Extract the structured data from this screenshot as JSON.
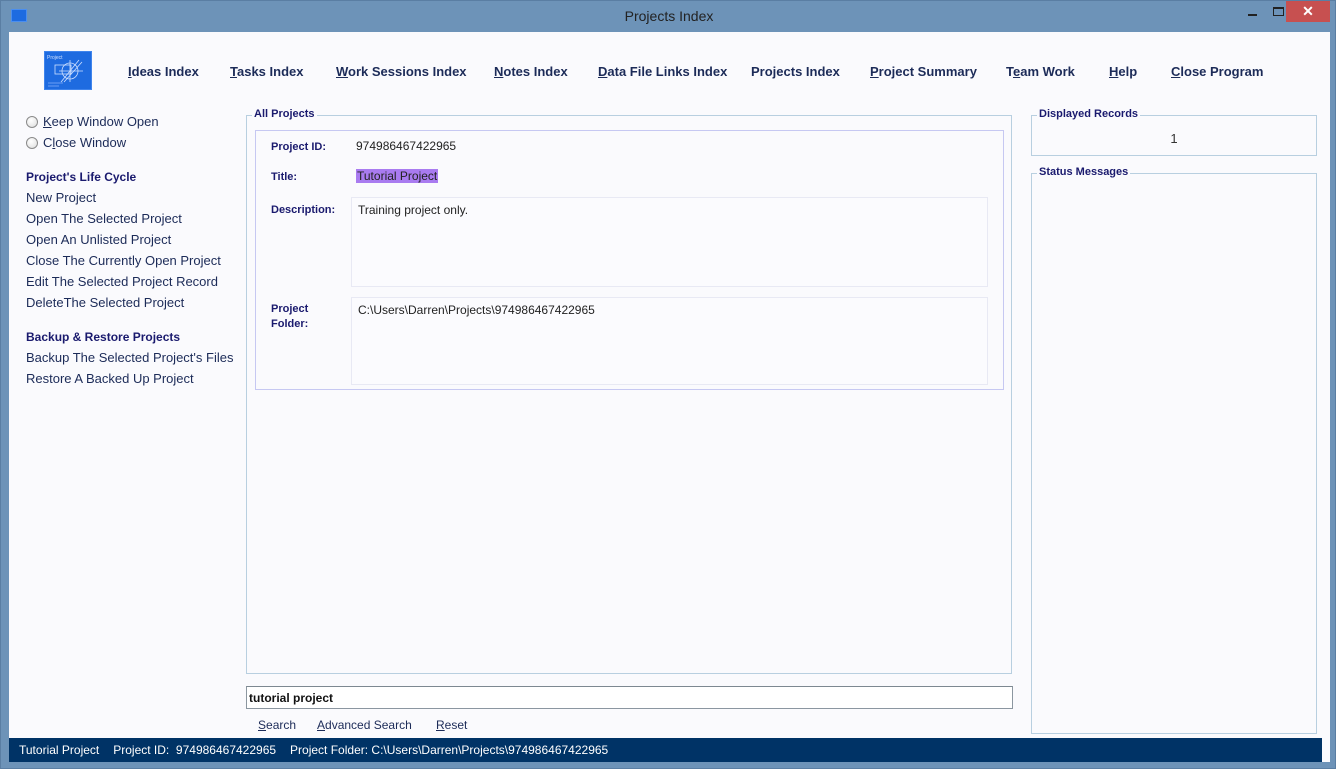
{
  "window": {
    "title": "Projects Index",
    "minimize_label": "minimize",
    "maximize_label": "maximize",
    "close_glyph": "✕"
  },
  "logo": {
    "caption": "Project",
    "icon": "project-logo-icon"
  },
  "nav": [
    {
      "key": "I",
      "rest": "deas Index"
    },
    {
      "key": "T",
      "rest": "asks Index"
    },
    {
      "key": "W",
      "rest": "ork Sessions Index"
    },
    {
      "key": "N",
      "rest": "otes Index"
    },
    {
      "key": "D",
      "rest": "ata File Links Index"
    },
    {
      "key": "",
      "rest": "Projects Index"
    },
    {
      "key": "P",
      "rest": "roject Summary"
    },
    {
      "pre": "T",
      "key": "e",
      "rest": "am Work"
    },
    {
      "key": "H",
      "rest": "elp"
    },
    {
      "key": "C",
      "rest": "lose Program"
    }
  ],
  "sidebar": {
    "radios": [
      {
        "key": "K",
        "rest": "eep Window Open"
      },
      {
        "pre": "C",
        "key": "l",
        "rest": "ose Window"
      }
    ],
    "sections": [
      {
        "heading": "Project's Life Cycle",
        "links": [
          "New Project",
          "Open The Selected Project",
          "Open An Unlisted Project",
          "Close The Currently Open Project",
          "Edit The Selected Project Record",
          "DeleteThe Selected Project"
        ]
      },
      {
        "heading": "Backup & Restore Projects",
        "links": [
          "Backup The Selected Project's Files",
          "Restore A Backed Up Project"
        ]
      }
    ]
  },
  "main": {
    "group_title": "All Projects",
    "record": {
      "id_label": "Project ID:",
      "id_value": "974986467422965",
      "title_label": "Title:",
      "title_value": "Tutorial Project",
      "description_label": "Description:",
      "description_value": "Training project only.",
      "folder_label_1": "Project",
      "folder_label_2": "Folder:",
      "folder_value": "C:\\Users\\Darren\\Projects\\974986467422965"
    },
    "search": {
      "value": "tutorial project",
      "buttons": [
        {
          "key": "S",
          "rest": "earch"
        },
        {
          "key": "A",
          "rest": "dvanced Search"
        },
        {
          "key": "R",
          "rest": "eset"
        }
      ]
    }
  },
  "right": {
    "records_title": "Displayed Records",
    "records_value": "1",
    "status_title": "Status Messages"
  },
  "status_bar": {
    "title": "Tutorial Project",
    "id_text": "Project ID:  974986467422965",
    "folder_text": "Project Folder: C:\\Users\\Darren\\Projects\\974986467422965"
  },
  "colors": {
    "frame": "#6d93b8",
    "status_bar": "#003366",
    "title_highlight": "#a97bf0",
    "close_button": "#c75050",
    "label_text": "#1a1a6e"
  }
}
